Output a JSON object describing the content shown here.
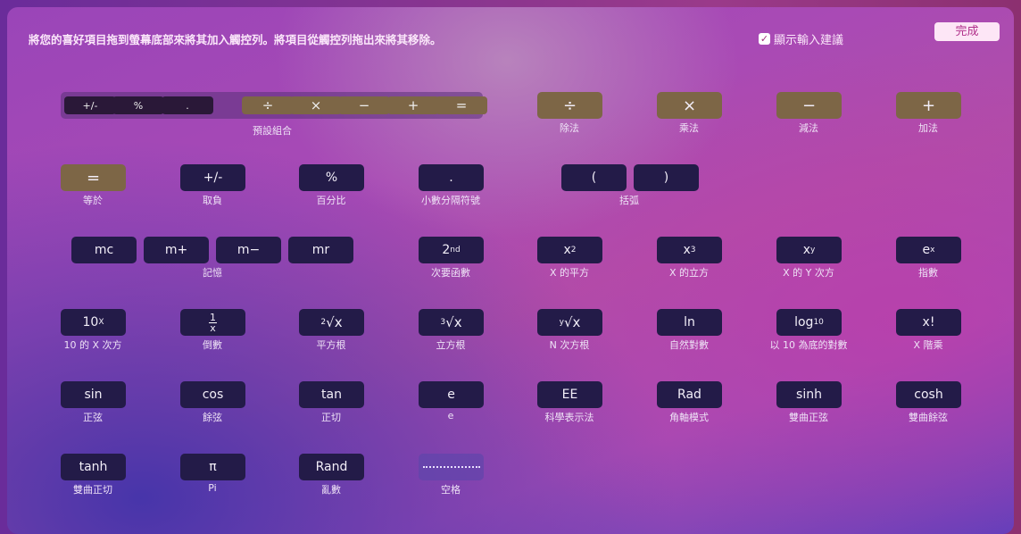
{
  "header": {
    "instruction": "將您的喜好項目拖到螢幕底部來將其加入觸控列。將項目從觸控列拖出來將其移除。",
    "suggestions_label": "顯示輸入建議",
    "suggestions_checked": true,
    "done_label": "完成"
  },
  "colors": {
    "key_dark": "#231b48",
    "key_operator": "#7d6646",
    "done_bg": "#fde6f6"
  },
  "default_set": {
    "label": "預設組合",
    "keys": [
      "+/-",
      "%",
      ".",
      "÷",
      "×",
      "−",
      "+",
      "="
    ]
  },
  "items": [
    {
      "id": "divide",
      "key": "÷",
      "label": "除法",
      "op": true
    },
    {
      "id": "multiply",
      "key": "×",
      "label": "乘法",
      "op": true
    },
    {
      "id": "subtract",
      "key": "−",
      "label": "減法",
      "op": true
    },
    {
      "id": "add",
      "key": "+",
      "label": "加法",
      "op": true
    },
    {
      "id": "equals",
      "key": "=",
      "label": "等於",
      "op": true
    },
    {
      "id": "negate",
      "key": "+/-",
      "label": "取負"
    },
    {
      "id": "percent",
      "key": "%",
      "label": "百分比"
    },
    {
      "id": "decimal",
      "key": ".",
      "label": "小數分隔符號"
    },
    {
      "id": "second",
      "key": "2",
      "sup": "nd",
      "label": "次要函數"
    },
    {
      "id": "x-squared",
      "key": "x",
      "sup": "2",
      "label": "X 的平方"
    },
    {
      "id": "x-cubed",
      "key": "x",
      "sup": "3",
      "label": "X 的立方"
    },
    {
      "id": "x-to-y",
      "key": "x",
      "sup": "y",
      "label": "X 的 Y 次方"
    },
    {
      "id": "e-to-x",
      "key": "e",
      "sup": "x",
      "label": "指數"
    },
    {
      "id": "ten-to-x",
      "key": "10",
      "sup": "X",
      "label": "10 的 X 次方"
    },
    {
      "id": "reciprocal",
      "frac": [
        "1",
        "x"
      ],
      "label": "倒數"
    },
    {
      "id": "square-root",
      "root": "2",
      "key": "√x",
      "label": "平方根"
    },
    {
      "id": "cube-root",
      "root": "3",
      "key": "√x",
      "label": "立方根"
    },
    {
      "id": "nth-root",
      "root": "y",
      "key": "√x",
      "label": "N 次方根"
    },
    {
      "id": "ln",
      "key": "ln",
      "label": "自然對數"
    },
    {
      "id": "log10",
      "key": "log",
      "sub": "10",
      "label": "以 10 為底的對數"
    },
    {
      "id": "factorial",
      "key": "x!",
      "label": "X 階乘"
    },
    {
      "id": "sin",
      "key": "sin",
      "label": "正弦"
    },
    {
      "id": "cos",
      "key": "cos",
      "label": "餘弦"
    },
    {
      "id": "tan",
      "key": "tan",
      "label": "正切"
    },
    {
      "id": "e",
      "key": "e",
      "label": "e"
    },
    {
      "id": "ee",
      "key": "EE",
      "label": "科學表示法"
    },
    {
      "id": "rad",
      "key": "Rad",
      "label": "角軸模式"
    },
    {
      "id": "sinh",
      "key": "sinh",
      "label": "雙曲正弦"
    },
    {
      "id": "cosh",
      "key": "cosh",
      "label": "雙曲餘弦"
    },
    {
      "id": "tanh",
      "key": "tanh",
      "label": "雙曲正切"
    },
    {
      "id": "pi",
      "key": "π",
      "label": "Pi"
    },
    {
      "id": "rand",
      "key": "Rand",
      "label": "亂數"
    },
    {
      "id": "space",
      "key": "",
      "label": "空格",
      "space": true
    }
  ],
  "parentheses": {
    "keys": [
      "(",
      ")"
    ],
    "label": "括弧"
  },
  "memory": {
    "keys": [
      "mc",
      "m+",
      "m−",
      "mr"
    ],
    "label": "記憶"
  }
}
